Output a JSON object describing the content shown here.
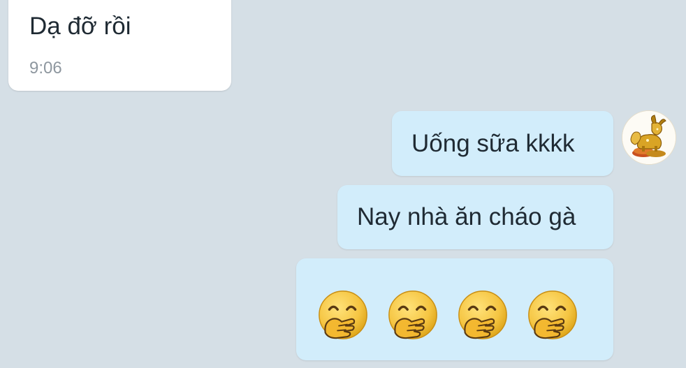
{
  "conversation": {
    "incoming": {
      "text": "Dạ đỡ rồi",
      "time": "9:06"
    },
    "outgoing": [
      {
        "text": "Uống sữa kkkk"
      },
      {
        "text": "Nay nhà ăn cháo gà"
      }
    ],
    "emoji_message": {
      "emojis": [
        "hand-over-mouth-emoji",
        "hand-over-mouth-emoji",
        "hand-over-mouth-emoji",
        "hand-over-mouth-emoji"
      ]
    }
  },
  "colors": {
    "background": "#d5dfe6",
    "incoming_bubble": "#ffffff",
    "outgoing_bubble": "#d2edfb",
    "text": "#1f2a33",
    "timestamp": "#8e979f",
    "emoji_face": "#f5c542"
  },
  "avatar": {
    "icon": "golden-goat-figurine-avatar"
  }
}
